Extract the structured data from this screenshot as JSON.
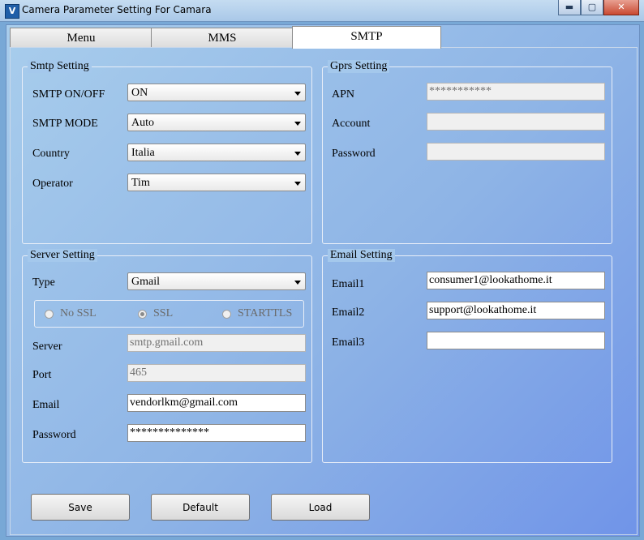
{
  "window": {
    "title": "Camera Parameter Setting For  Camara",
    "icon": "app-logo-icon",
    "controls": {
      "minimize": "▬",
      "maximize": "▢",
      "close": "✕"
    }
  },
  "tabs": [
    {
      "label": "Menu",
      "active": false
    },
    {
      "label": "MMS",
      "active": false
    },
    {
      "label": "SMTP",
      "active": true
    }
  ],
  "smtp_setting": {
    "title": "Smtp Setting",
    "on_off": {
      "label": "SMTP ON/OFF",
      "value": "ON"
    },
    "mode": {
      "label": "SMTP MODE",
      "value": "Auto"
    },
    "country": {
      "label": "Country",
      "value": "Italia"
    },
    "operator": {
      "label": "Operator",
      "value": "Tim"
    }
  },
  "gprs_setting": {
    "title": "Gprs Setting",
    "apn": {
      "label": "APN",
      "value": "***********"
    },
    "account": {
      "label": "Account",
      "value": ""
    },
    "password": {
      "label": "Password",
      "value": ""
    }
  },
  "server_setting": {
    "title": "Server Setting",
    "type": {
      "label": "Type",
      "value": "Gmail"
    },
    "security": {
      "options": [
        "No SSL",
        "SSL",
        "STARTTLS"
      ],
      "selected": "SSL"
    },
    "server": {
      "label": "Server",
      "value": "smtp.gmail.com"
    },
    "port": {
      "label": "Port",
      "value": "465"
    },
    "email": {
      "label": "Email",
      "value": "vendorlkm@gmail.com"
    },
    "password": {
      "label": "Password",
      "value": "**************"
    }
  },
  "email_setting": {
    "title": "Email Setting",
    "email1": {
      "label": "Email1",
      "value": "consumer1@lookathome.it"
    },
    "email2": {
      "label": "Email2",
      "value": "support@lookathome.it"
    },
    "email3": {
      "label": "Email3",
      "value": ""
    }
  },
  "buttons": {
    "save": "Save",
    "default": "Default",
    "load": "Load"
  }
}
